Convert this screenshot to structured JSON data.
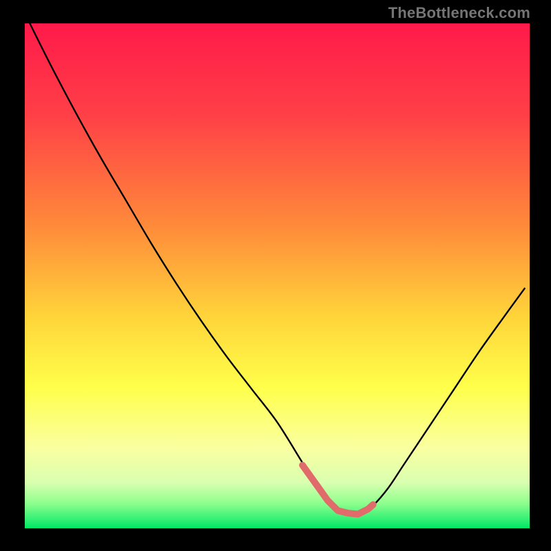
{
  "attribution": "TheBottleneck.com",
  "chart_data": {
    "type": "line",
    "title": "",
    "xlabel": "",
    "ylabel": "",
    "xlim": [
      0,
      100
    ],
    "ylim": [
      0,
      100
    ],
    "gradient_stops": [
      {
        "offset": 0,
        "color": "#ff1a4a"
      },
      {
        "offset": 18,
        "color": "#ff3f47"
      },
      {
        "offset": 40,
        "color": "#ff8a3a"
      },
      {
        "offset": 58,
        "color": "#ffd43a"
      },
      {
        "offset": 72,
        "color": "#ffff4a"
      },
      {
        "offset": 84,
        "color": "#faffa0"
      },
      {
        "offset": 91,
        "color": "#d9ffb0"
      },
      {
        "offset": 95,
        "color": "#8fff8f"
      },
      {
        "offset": 100,
        "color": "#00e865"
      }
    ],
    "series": [
      {
        "name": "bottleneck-curve",
        "color": "#000000",
        "x": [
          1,
          5,
          10,
          15,
          20,
          25,
          30,
          35,
          40,
          45,
          50,
          55,
          57,
          60,
          62,
          65,
          67,
          69,
          72,
          75,
          80,
          85,
          90,
          95,
          99
        ],
        "values": [
          100,
          92.0,
          82.5,
          73.5,
          65.0,
          56.5,
          48.5,
          41.0,
          34.0,
          27.5,
          21.0,
          13.0,
          10.0,
          5.5,
          3.5,
          2.6,
          3.0,
          4.5,
          8.0,
          12.5,
          20.0,
          27.5,
          35.0,
          42.0,
          47.5
        ]
      },
      {
        "name": "highlight-band",
        "color": "#e16a6a",
        "stroke_width": 7,
        "x": [
          55,
          57.5,
          60,
          62,
          64,
          66,
          68,
          69
        ],
        "values": [
          12.5,
          9.0,
          5.5,
          3.5,
          3.0,
          2.8,
          3.8,
          4.7
        ]
      }
    ]
  }
}
